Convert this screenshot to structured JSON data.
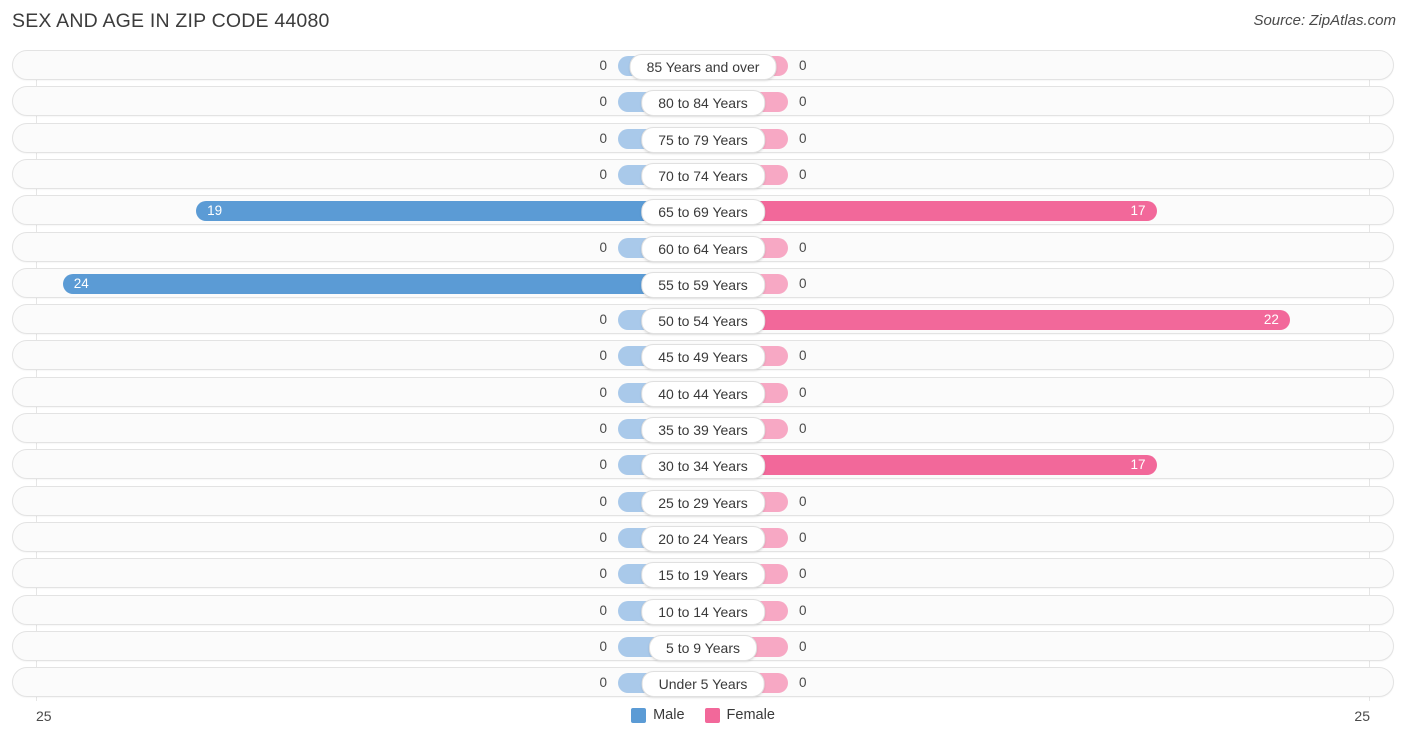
{
  "header": {
    "title": "SEX AND AGE IN ZIP CODE 44080",
    "source": "Source: ZipAtlas.com"
  },
  "legend": {
    "male": {
      "label": "Male",
      "color": "#5b9bd5"
    },
    "female": {
      "label": "Female",
      "color": "#f2689a"
    }
  },
  "axis": {
    "left_max": "25",
    "right_max": "25"
  },
  "colors": {
    "male": "#5b9bd5",
    "female": "#f2689a",
    "male_zero": "#a9c9ea",
    "female_zero": "#f7a8c4",
    "row_border": "#e3e3e3",
    "row_background": "#fbfbfb"
  },
  "chart_data": {
    "type": "bar",
    "subtype": "population-pyramid",
    "title": "SEX AND AGE IN ZIP CODE 44080",
    "xlabel": "",
    "ylabel": "",
    "xlim": [
      25,
      25
    ],
    "grid": true,
    "legend_position": "bottom-center",
    "categories": [
      "85 Years and over",
      "80 to 84 Years",
      "75 to 79 Years",
      "70 to 74 Years",
      "65 to 69 Years",
      "60 to 64 Years",
      "55 to 59 Years",
      "50 to 54 Years",
      "45 to 49 Years",
      "40 to 44 Years",
      "35 to 39 Years",
      "30 to 34 Years",
      "25 to 29 Years",
      "20 to 24 Years",
      "15 to 19 Years",
      "10 to 14 Years",
      "5 to 9 Years",
      "Under 5 Years"
    ],
    "series": [
      {
        "name": "Male",
        "color": "#5b9bd5",
        "values": [
          0,
          0,
          0,
          0,
          19,
          0,
          24,
          0,
          0,
          0,
          0,
          0,
          0,
          0,
          0,
          0,
          0,
          0
        ]
      },
      {
        "name": "Female",
        "color": "#f2689a",
        "values": [
          0,
          0,
          0,
          0,
          17,
          0,
          0,
          22,
          0,
          0,
          0,
          17,
          0,
          0,
          0,
          0,
          0,
          0
        ]
      }
    ]
  }
}
